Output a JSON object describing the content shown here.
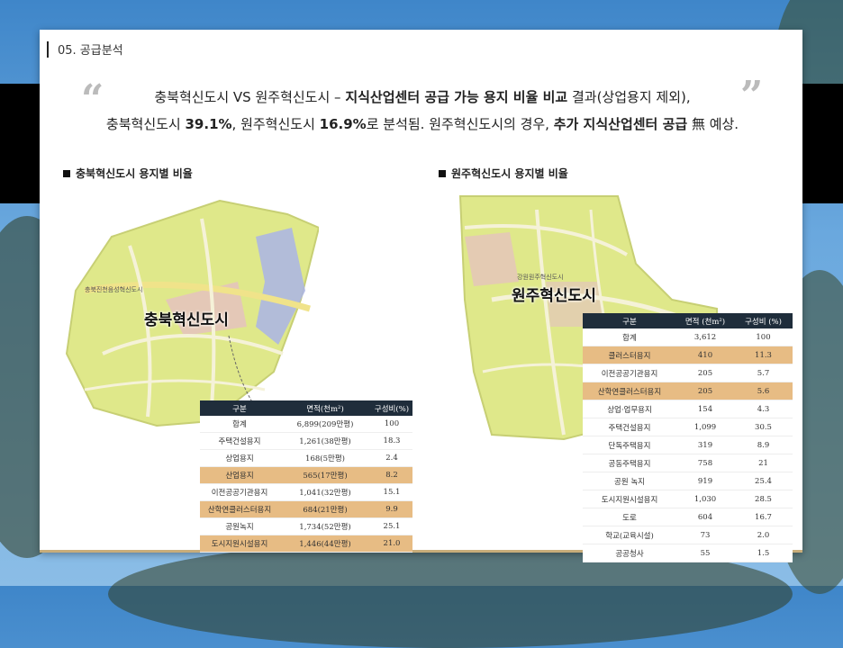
{
  "section": {
    "label": "05. 공급분석"
  },
  "summary": {
    "open_quote": "“",
    "close_quote": "”",
    "line1": [
      {
        "text": "충북혁신도시 VS 원주혁신도시 – ",
        "bold": false
      },
      {
        "text": "지식산업센터 공급 가능 용지 비율 비교",
        "bold": true
      },
      {
        "text": " 결과(상업용지 제외),",
        "bold": false
      }
    ],
    "line2": [
      {
        "text": "충북혁신도시 ",
        "bold": false
      },
      {
        "text": "39.1%",
        "bold": true
      },
      {
        "text": ", 원주혁신도시 ",
        "bold": false
      },
      {
        "text": "16.9%",
        "bold": true
      },
      {
        "text": "로 분석됨. 원주혁신도시의 경우, ",
        "bold": false
      },
      {
        "text": "추가 지식산업센터 공급",
        "bold": true
      },
      {
        "text": " 無 예상.",
        "bold": false
      }
    ]
  },
  "left": {
    "title": "충북혁신도시 용지별 비율",
    "map_label": "충북혁신도시",
    "map_sublabel": "충북진천음성혁신도시",
    "headers": [
      "구분",
      "면적(천m²)",
      "구성비(%)"
    ],
    "rows": [
      {
        "name": "합계",
        "area": "6,899(209만평)",
        "ratio": "100",
        "highlight": false
      },
      {
        "name": "주택건설용지",
        "area": "1,261(38만평)",
        "ratio": "18.3",
        "highlight": false
      },
      {
        "name": "상업용지",
        "area": "168(5만평)",
        "ratio": "2.4",
        "highlight": false
      },
      {
        "name": "산업용지",
        "area": "565(17만평)",
        "ratio": "8.2",
        "highlight": true
      },
      {
        "name": "이전공공기관용지",
        "area": "1,041(32만평)",
        "ratio": "15.1",
        "highlight": false
      },
      {
        "name": "산학연클러스터용지",
        "area": "684(21만평)",
        "ratio": "9.9",
        "highlight": true
      },
      {
        "name": "공원녹지",
        "area": "1,734(52만평)",
        "ratio": "25.1",
        "highlight": false
      },
      {
        "name": "도시지원시설용지",
        "area": "1,446(44만평)",
        "ratio": "21.0",
        "highlight": true
      }
    ]
  },
  "right": {
    "title": "원주혁신도시 용지별 비율",
    "map_label": "원주혁신도시",
    "map_sublabel": "강원원주혁신도시",
    "headers": [
      "구분",
      "면적 (천m²)",
      "구성비 (%)"
    ],
    "rows": [
      {
        "name": "합계",
        "area": "3,612",
        "ratio": "100",
        "highlight": false
      },
      {
        "name": "클러스터용지",
        "area": "410",
        "ratio": "11.3",
        "highlight": true
      },
      {
        "name": "이전공공기관용지",
        "area": "205",
        "ratio": "5.7",
        "highlight": false
      },
      {
        "name": "산학연클러스터용지",
        "area": "205",
        "ratio": "5.6",
        "highlight": true
      },
      {
        "name": "상업·업무용지",
        "area": "154",
        "ratio": "4.3",
        "highlight": false
      },
      {
        "name": "주택건설용지",
        "area": "1,099",
        "ratio": "30.5",
        "highlight": false
      },
      {
        "name": "단독주택용지",
        "area": "319",
        "ratio": "8.9",
        "highlight": false
      },
      {
        "name": "공동주택용지",
        "area": "758",
        "ratio": "21",
        "highlight": false
      },
      {
        "name": "공원 녹지",
        "area": "919",
        "ratio": "25.4",
        "highlight": false
      },
      {
        "name": "도시지원시설용지",
        "area": "1,030",
        "ratio": "28.5",
        "highlight": false
      },
      {
        "name": "도로",
        "area": "604",
        "ratio": "16.7",
        "highlight": false
      },
      {
        "name": "학교(교육시설)",
        "area": "73",
        "ratio": "2.0",
        "highlight": false
      },
      {
        "name": "공공청사",
        "area": "55",
        "ratio": "1.5",
        "highlight": false
      }
    ]
  },
  "colors": {
    "header_bg": "#1f2d3b",
    "highlight_row": "#e7bc84",
    "map_base": "#dfe88a",
    "map_road": "#f5f2d8",
    "map_pink": "#e7b3d6",
    "map_blue": "#aab4e6",
    "card_border": "#c8ad7a"
  }
}
